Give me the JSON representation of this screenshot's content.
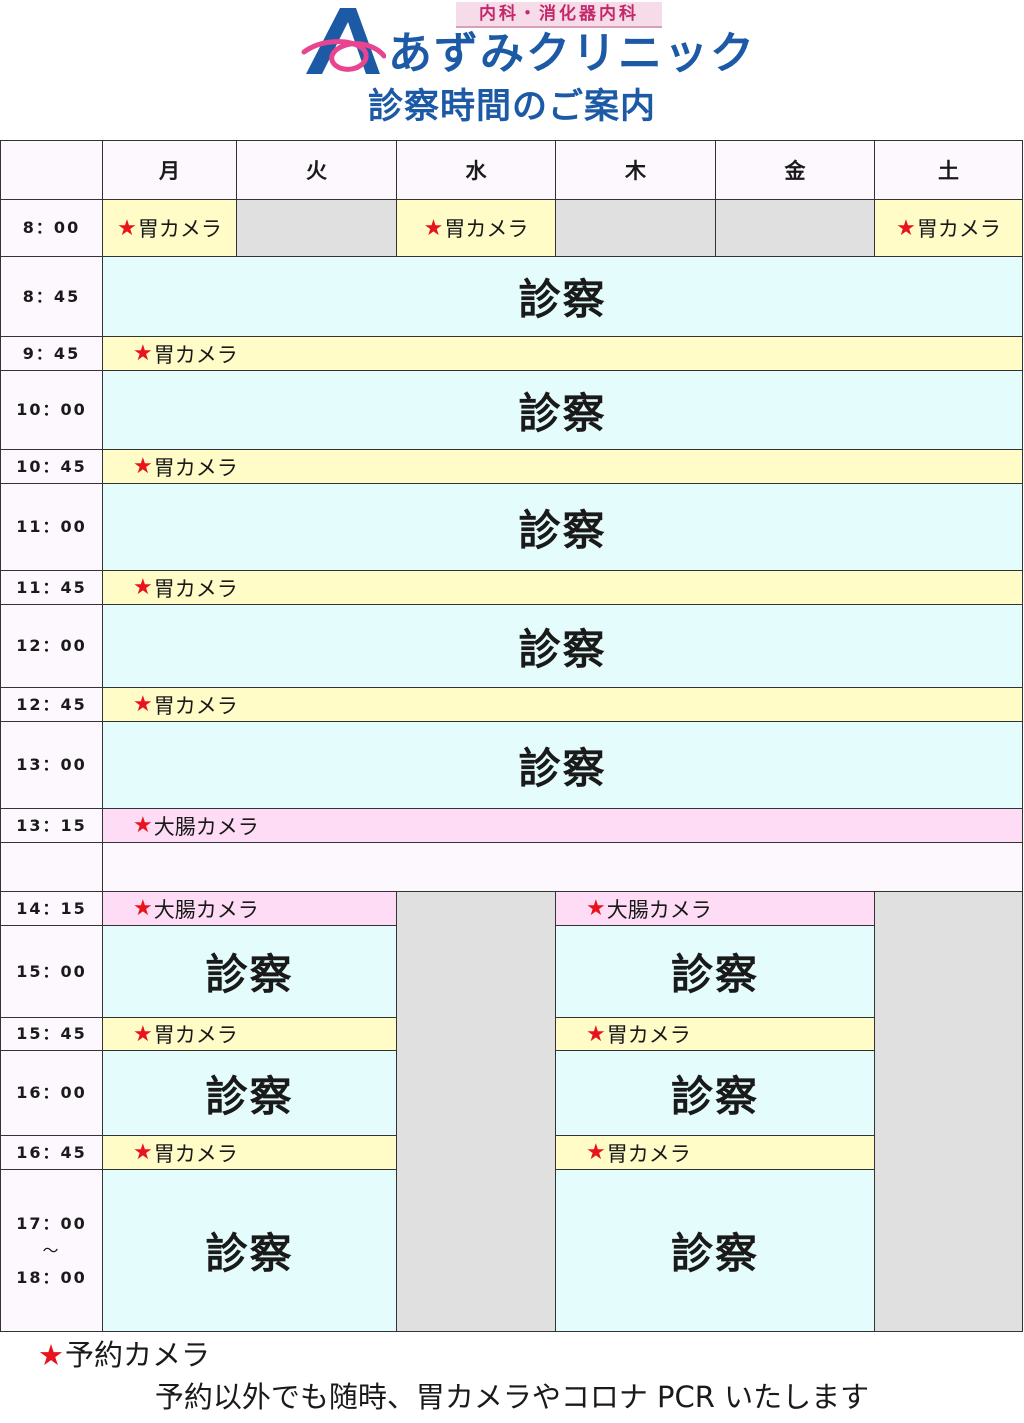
{
  "header": {
    "subtitle": "内科・消化器内科",
    "clinic_name": "あずみクリニック",
    "title": "診察時間のご案内"
  },
  "days": [
    "月",
    "火",
    "水",
    "木",
    "金",
    "土"
  ],
  "times": {
    "t800": "8：00",
    "t845": "8：45",
    "t945": "9：45",
    "t1000": "10：00",
    "t1045": "10：45",
    "t1100": "11：00",
    "t1145": "11：45",
    "t1200": "12：00",
    "t1245": "12：45",
    "t1300": "13：00",
    "t1315": "13：15",
    "t1415": "14：15",
    "t1500": "15：00",
    "t1545": "15：45",
    "t1600": "16：00",
    "t1645": "16：45",
    "t1700": "17：00",
    "tilde": "～",
    "t1800": "18：00"
  },
  "labels": {
    "star": "★",
    "gastro_camera": "胃カメラ",
    "colon_camera": "大腸カメラ",
    "consultation": "診察"
  },
  "footer": {
    "legend_star": "★",
    "legend_text": "予約カメラ",
    "note": "予約以外でも随時、胃カメラやコロナ PCR いたします"
  },
  "colors": {
    "brand_blue": "#1c5aa6",
    "brand_pink": "#c3286b",
    "camera_yellow": "#fffcc8",
    "colon_pink": "#ffdcf5",
    "consultation_cyan": "#e4fcfc",
    "closed_gray": "#e0e0e0",
    "star_red": "#e8141d"
  }
}
